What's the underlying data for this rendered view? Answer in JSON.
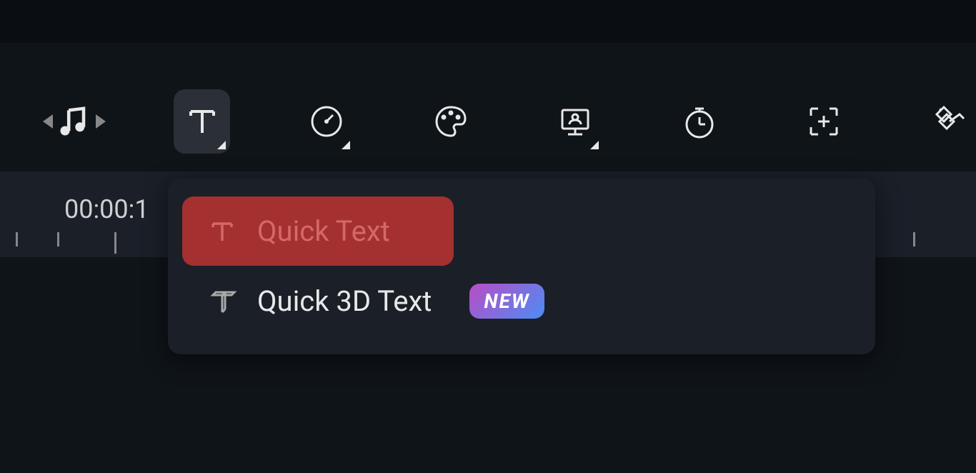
{
  "toolbar": {
    "items": [
      {
        "name": "audio",
        "hasDropdown": false
      },
      {
        "name": "text",
        "hasDropdown": true,
        "active": true
      },
      {
        "name": "speed",
        "hasDropdown": true
      },
      {
        "name": "color",
        "hasDropdown": false
      },
      {
        "name": "media",
        "hasDropdown": true
      },
      {
        "name": "timer",
        "hasDropdown": false
      },
      {
        "name": "crop",
        "hasDropdown": false
      },
      {
        "name": "keyframe",
        "hasDropdown": false
      }
    ]
  },
  "timeline": {
    "timecode": "00:00:1"
  },
  "textMenu": {
    "items": [
      {
        "label": "Quick Text",
        "highlighted": true,
        "badge": null
      },
      {
        "label": "Quick 3D Text",
        "highlighted": false,
        "badge": "NEW"
      }
    ]
  }
}
